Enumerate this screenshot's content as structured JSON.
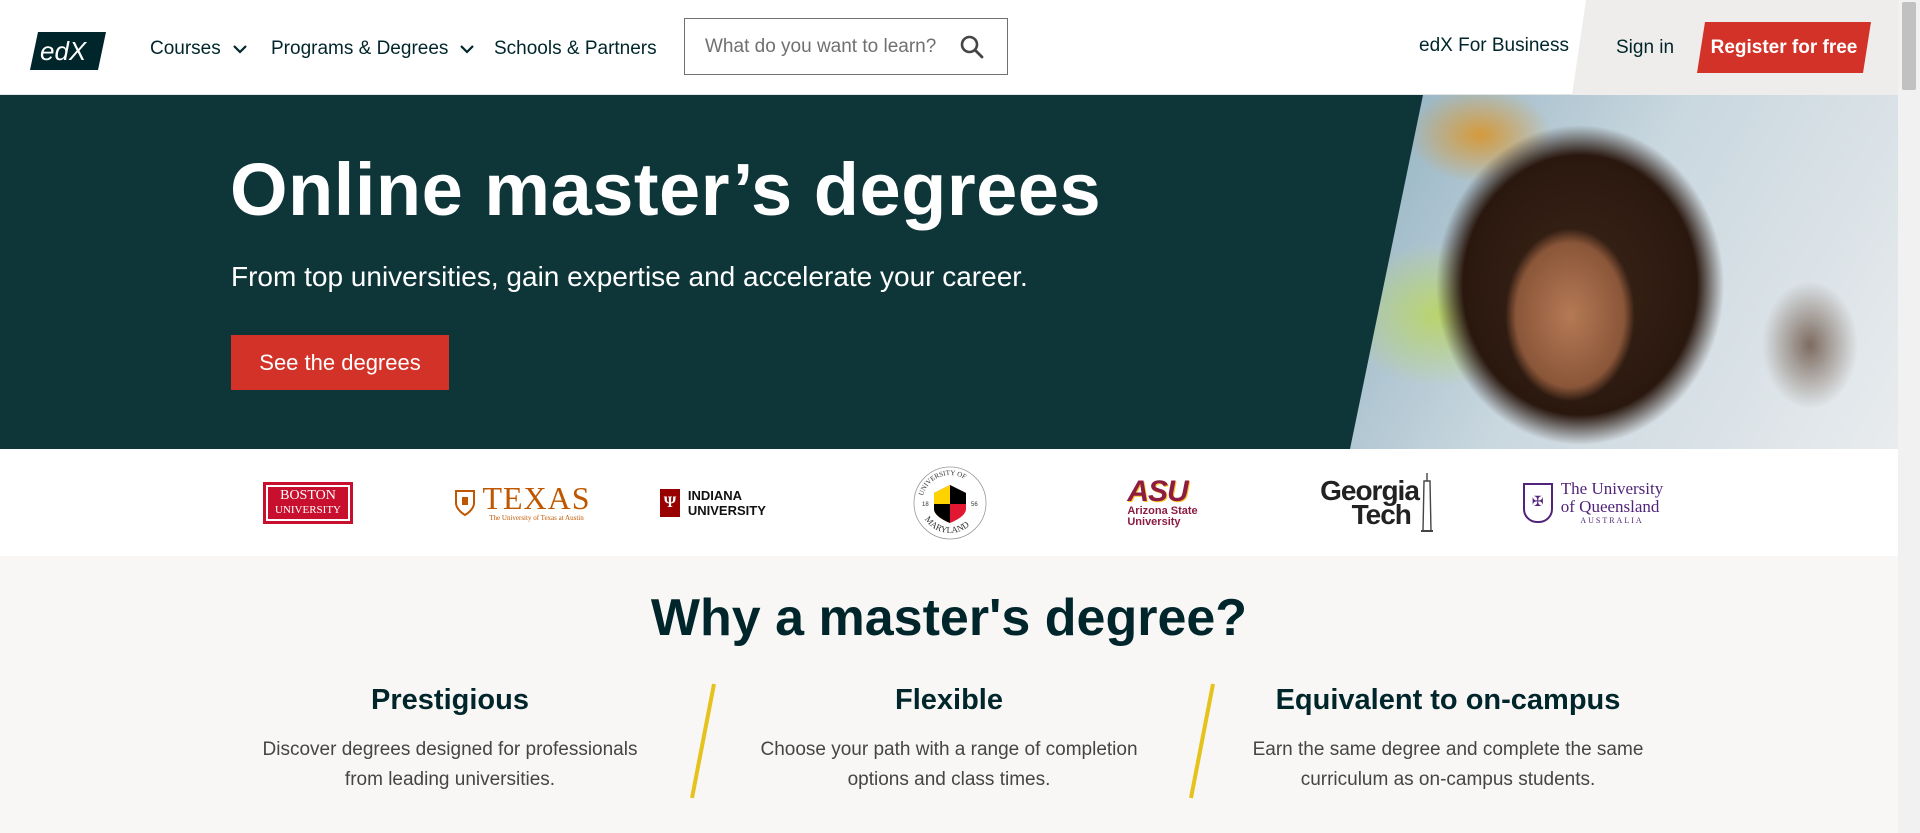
{
  "header": {
    "logo_text": "edX",
    "nav": [
      {
        "label": "Courses"
      },
      {
        "label": "Programs & Degrees"
      },
      {
        "label": "Schools & Partners"
      }
    ],
    "search_placeholder": "What do you want to learn?",
    "business_link": "edX For Business",
    "sign_in": "Sign in",
    "register": "Register for free"
  },
  "hero": {
    "title": "Online master’s degrees",
    "subtitle": "From top universities, gain expertise and accelerate your career.",
    "cta": "See the degrees"
  },
  "partners": {
    "boston": {
      "line1": "BOSTON",
      "line2": "UNIVERSITY"
    },
    "texas": {
      "word": "TEXAS",
      "sub": "The University of Texas at Austin"
    },
    "indiana": "INDIANA UNIVERSITY",
    "maryland": {
      "top": "UNIVERSITY OF",
      "bottom": "MARYLAND",
      "y1": "18",
      "y2": "56"
    },
    "asu": {
      "mark": "ASU",
      "line1": "Arizona State",
      "line2": "University"
    },
    "georgia": {
      "line1": "Georgia",
      "line2": "Tech"
    },
    "uq": {
      "line1": "The University",
      "line2": "of Queensland",
      "line3": "AUSTRALIA"
    }
  },
  "why": {
    "title": "Why a master's degree?",
    "columns": [
      {
        "heading": "Prestigious",
        "text": "Discover degrees designed for professionals from leading universities."
      },
      {
        "heading": "Flexible",
        "text": "Choose your path with a range of completion options and class times."
      },
      {
        "heading": "Equivalent to on-campus",
        "text": "Earn the same degree and complete the same curriculum as on-campus students."
      }
    ]
  },
  "colors": {
    "brand_dark": "#0e3639",
    "accent_red": "#d23228",
    "slash_yellow": "#e5c21c"
  },
  "icons": [
    "chevron-down-icon",
    "search-icon"
  ]
}
